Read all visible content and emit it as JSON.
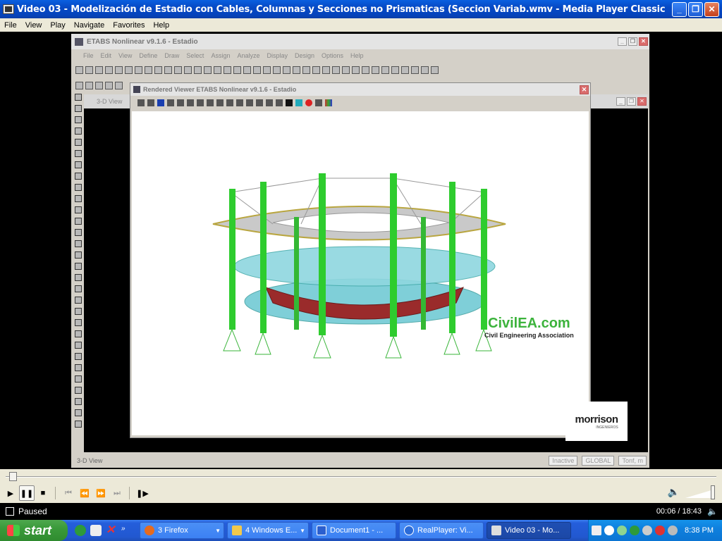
{
  "window": {
    "title": "Video 03 - Modelización de Estadio con Cables, Columnas y Secciones no Prismaticas (Seccion Variab.wmv - Media Player Classic",
    "minimize_glyph": "_",
    "maximize_glyph": "❐",
    "close_glyph": "✕"
  },
  "menu": [
    "File",
    "View",
    "Play",
    "Navigate",
    "Favorites",
    "Help"
  ],
  "video": {
    "etabs_title": "ETABS Nonlinear v9.1.6 - Estadio",
    "etabs_menu": [
      "File",
      "Edit",
      "View",
      "Define",
      "Draw",
      "Select",
      "Assign",
      "Analyze",
      "Display",
      "Design",
      "Options",
      "Help"
    ],
    "view_title": "3-D View",
    "rendered_title": "Rendered Viewer ETABS Nonlinear v9.1.6 - Estadio",
    "status_left": "3-D View",
    "status_fields": [
      "Inactive",
      "GLOBAL",
      "Tonf, m"
    ],
    "watermark_main": "CivilEA.com",
    "watermark_sub": "Civil Engineering Association",
    "logo_main": "morrison",
    "logo_sub": "INGENIEROS"
  },
  "playback": {
    "state": "Paused",
    "elapsed": "00:06",
    "duration": "18:43",
    "time_text": "00:06 / 18:43",
    "progress": 0.005
  },
  "taskbar": {
    "start_label": "start",
    "buttons": [
      {
        "label": "3 Firefox",
        "icon_color": "#e66b1f",
        "active": false
      },
      {
        "label": "4 Windows E...",
        "icon_color": "#f2c94c",
        "active": false
      },
      {
        "label": "Document1 - ...",
        "icon_color": "#2b5fcf",
        "active": false
      },
      {
        "label": "RealPlayer: Vi...",
        "icon_color": "#2a6bd8",
        "active": false
      },
      {
        "label": "Video 03 - Mo...",
        "icon_color": "#dddddd",
        "active": true
      }
    ],
    "clock": "8:38 PM"
  }
}
